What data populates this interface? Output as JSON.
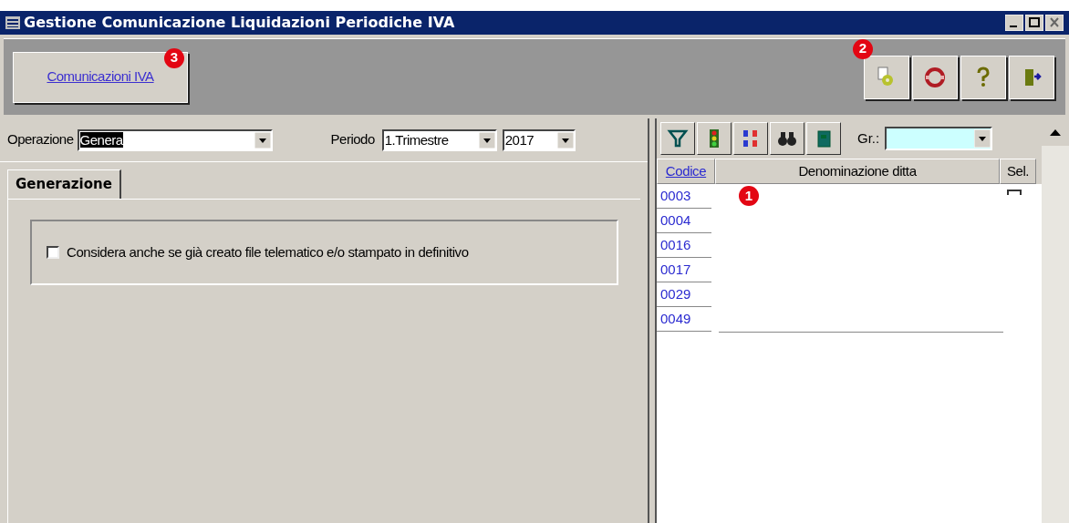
{
  "window": {
    "title": "Gestione Comunicazione Liquidazioni Periodiche IVA"
  },
  "toolbar": {
    "main_button": "Comunicazioni IVA",
    "main_button_callout": "3",
    "tools_callout": "2"
  },
  "filters": {
    "operazione_label": "Operazione",
    "operazione_value": "Genera",
    "periodo_label": "Periodo",
    "periodo_value": "1.Trimestre",
    "anno_value": "2017"
  },
  "tabs": [
    {
      "label": "Generazione",
      "selected": true
    }
  ],
  "options": [
    {
      "label": "Considera anche se già creato file telematico e/o stampato in definitivo",
      "checked": false
    }
  ],
  "list": {
    "group_label": "Gr.:",
    "columns": [
      "Codice",
      "Denominazione ditta",
      "Sel."
    ],
    "rows": [
      {
        "code": "0003",
        "kind": "with_checkbox",
        "checked": false
      },
      {
        "code": "0004",
        "kind": "plain"
      },
      {
        "code": "0016",
        "kind": "plain"
      },
      {
        "code": "0017",
        "kind": "plain"
      },
      {
        "code": "0029",
        "kind": "plain"
      },
      {
        "code": "0049",
        "kind": "plain"
      }
    ],
    "callout": "1"
  }
}
